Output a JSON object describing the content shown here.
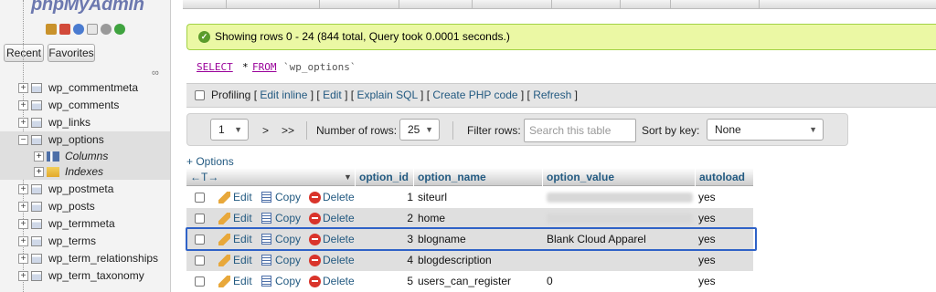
{
  "app": {
    "name": "phpMyAdmin",
    "recent_label": "Recent",
    "favorites_label": "Favorites"
  },
  "sidebar": {
    "tables": [
      {
        "label": "wp_commentmeta"
      },
      {
        "label": "wp_comments"
      },
      {
        "label": "wp_links"
      },
      {
        "label": "wp_options",
        "selected": true
      },
      {
        "label": "wp_postmeta"
      },
      {
        "label": "wp_posts"
      },
      {
        "label": "wp_termmeta"
      },
      {
        "label": "wp_terms"
      },
      {
        "label": "wp_term_relationships"
      },
      {
        "label": "wp_term_taxonomy"
      }
    ],
    "sub_items": [
      {
        "label": "Columns"
      },
      {
        "label": "Indexes"
      }
    ]
  },
  "message": {
    "success": "Showing rows 0 - 24 (844 total, Query took 0.0001 seconds.)",
    "color": "#ebf8a4"
  },
  "sql": {
    "select": "SELECT",
    "star": "*",
    "from": "FROM",
    "table": "`wp_options`"
  },
  "profiling": {
    "label": "Profiling",
    "open": " [ ",
    "sep": " ] [ ",
    "close": " ]",
    "edit_inline": "Edit inline",
    "edit": "Edit",
    "explain": "Explain SQL",
    "php_code": "Create PHP code",
    "refresh": "Refresh"
  },
  "navigation": {
    "page": "1",
    "next": ">",
    "last": ">>",
    "rows_label": "Number of rows:",
    "rows_value": "25",
    "filter_label": "Filter rows:",
    "filter_placeholder": "Search this table",
    "sort_label": "Sort by key:",
    "sort_value": "None"
  },
  "options_link": "+ Options",
  "table": {
    "arrows": "←T→",
    "columns": [
      "option_id",
      "option_name",
      "option_value",
      "autoload"
    ],
    "action_labels": {
      "edit": "Edit",
      "copy": "Copy",
      "delete": "Delete"
    },
    "rows": [
      {
        "option_id": "1",
        "option_name": "siteurl",
        "option_value": "",
        "autoload": "yes",
        "value_hidden": true
      },
      {
        "option_id": "2",
        "option_name": "home",
        "option_value": "",
        "autoload": "yes",
        "value_hidden": true
      },
      {
        "option_id": "3",
        "option_name": "blogname",
        "option_value": "Blank Cloud Apparel",
        "autoload": "yes",
        "highlighted": true
      },
      {
        "option_id": "4",
        "option_name": "blogdescription",
        "option_value": "",
        "autoload": "yes"
      },
      {
        "option_id": "5",
        "option_name": "users_can_register",
        "option_value": "0",
        "autoload": "yes"
      }
    ]
  },
  "colors": {
    "link": "#235a81",
    "highlight_border": "#2f62c7",
    "sql_keyword": "#990099"
  }
}
